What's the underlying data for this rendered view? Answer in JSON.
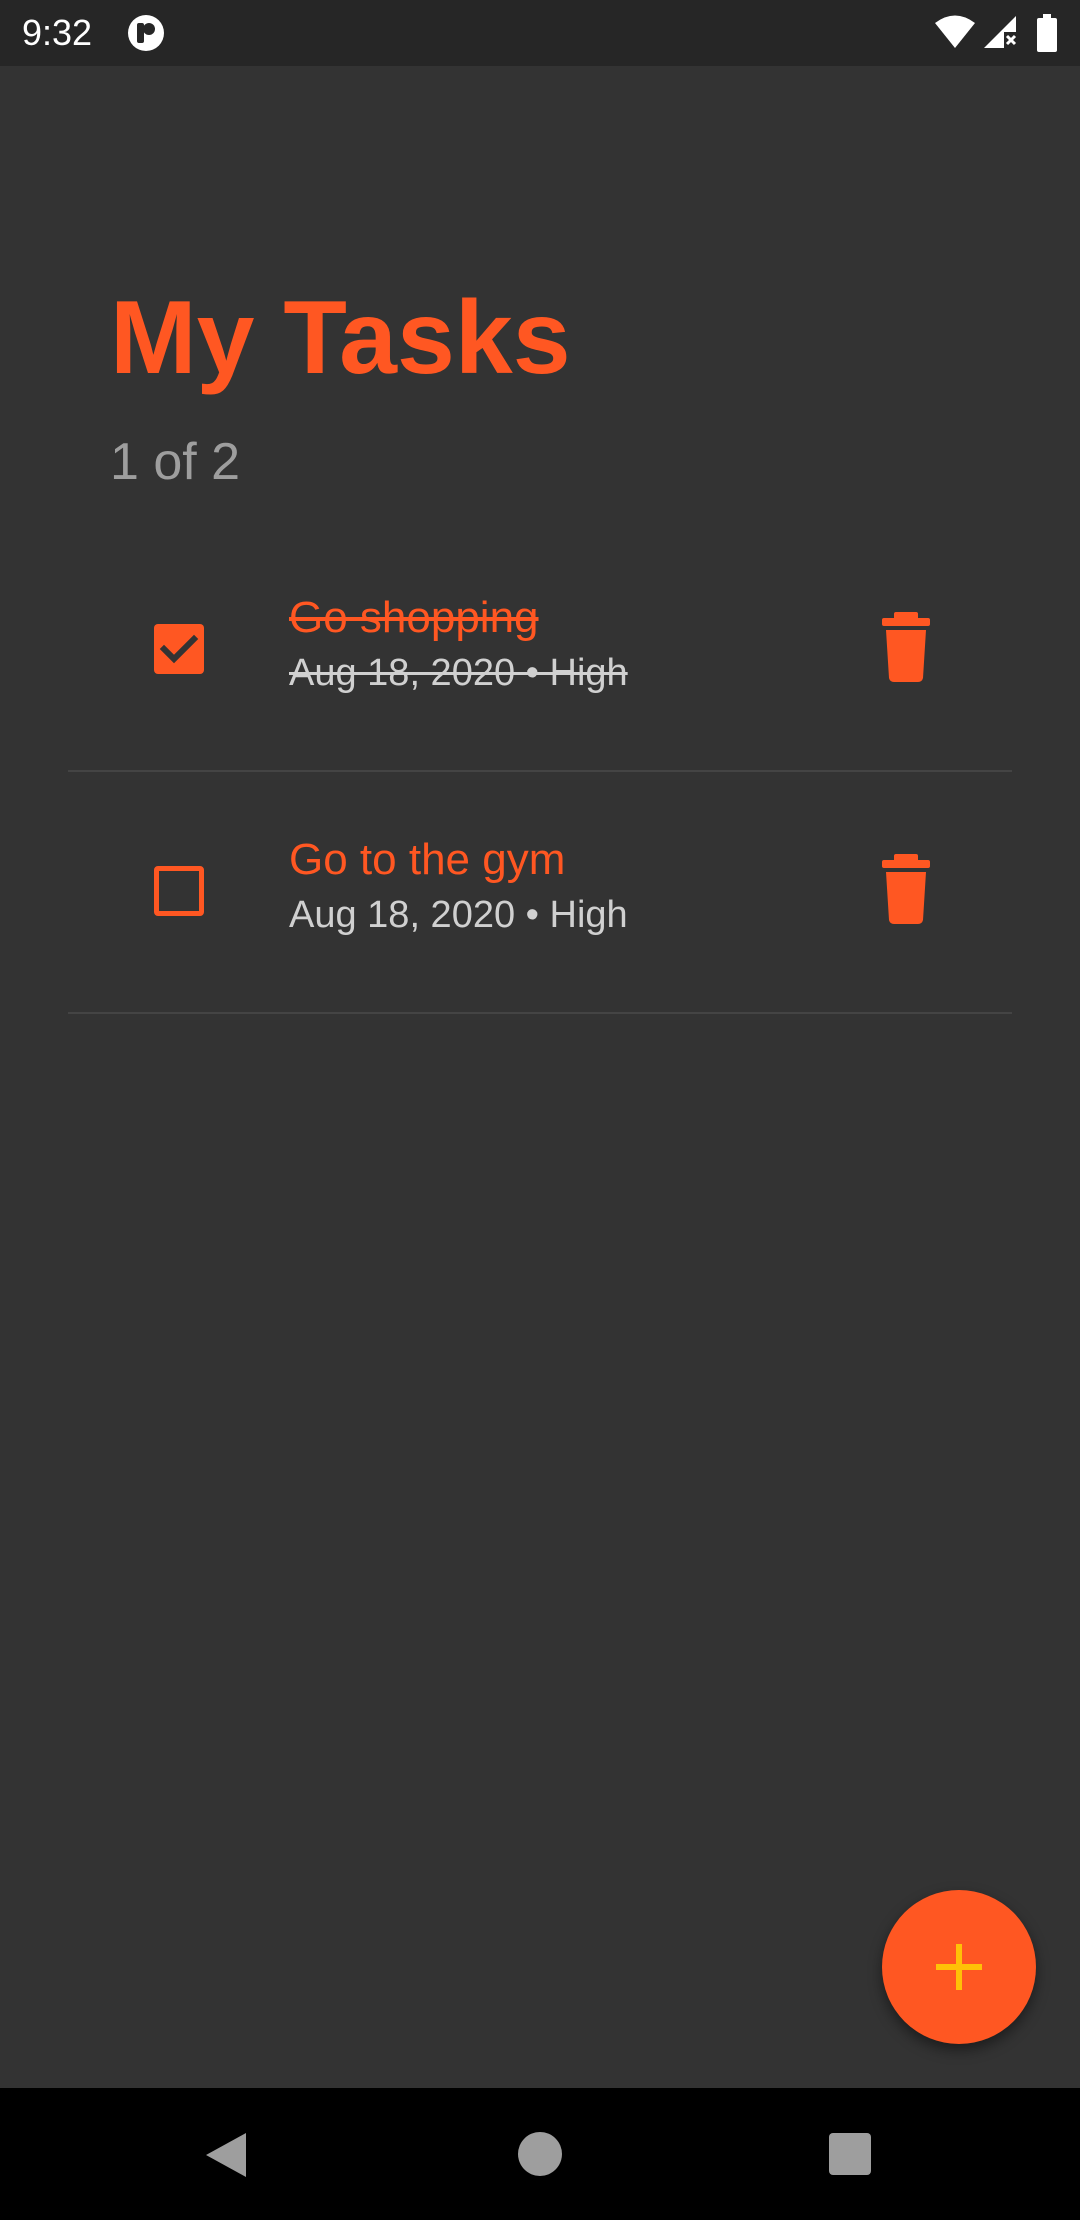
{
  "status_bar": {
    "time": "9:32",
    "icons": [
      "app-notification-icon",
      "wifi-icon",
      "signal-icon",
      "battery-icon"
    ]
  },
  "header": {
    "title": "My Tasks",
    "count": "1 of 2"
  },
  "tasks": [
    {
      "title": "Go shopping",
      "meta": "Aug 18, 2020 • High",
      "completed": true
    },
    {
      "title": "Go to the gym",
      "meta": "Aug 18, 2020 • High",
      "completed": false
    }
  ],
  "fab": {
    "icon": "plus-icon"
  },
  "nav_bar": {
    "icons": [
      "back-icon",
      "home-icon",
      "recents-icon"
    ]
  },
  "colors": {
    "accent": "#ff5722",
    "background": "#333333",
    "status_bar": "#262626",
    "fab_plus": "#ffc107",
    "subtitle": "#9e9e9e"
  }
}
